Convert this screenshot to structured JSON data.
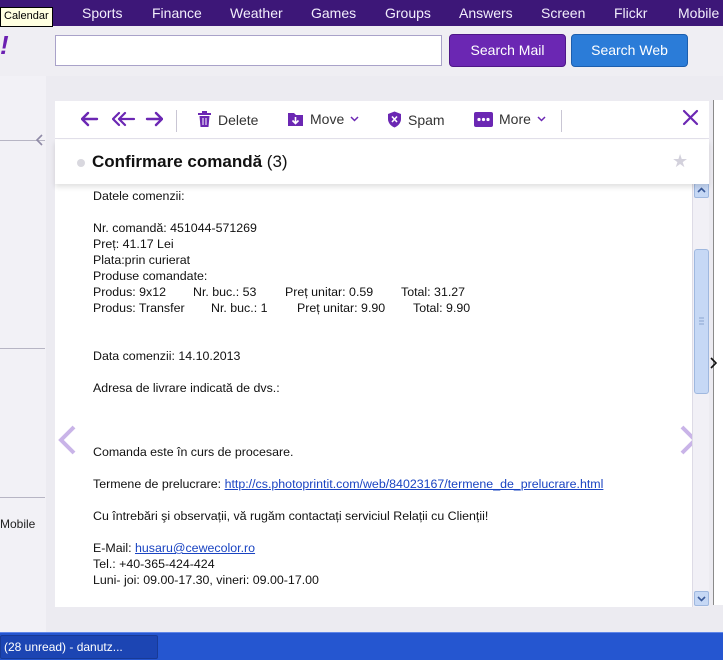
{
  "tooltip": "Calendar",
  "nav": {
    "items": [
      "Sports",
      "Finance",
      "Weather",
      "Games",
      "Groups",
      "Answers",
      "Screen",
      "Flickr",
      "Mobile"
    ]
  },
  "header": {
    "logo_fragment": "!",
    "search_value": "",
    "search_mail_label": "Search Mail",
    "search_web_label": "Search Web"
  },
  "sidebar": {
    "mobile_label": "Mobile"
  },
  "toolbar": {
    "reply_icon": "reply-icon",
    "reply_all_icon": "reply-all-icon",
    "forward_icon": "forward-icon",
    "delete_label": "Delete",
    "move_label": "Move",
    "spam_label": "Spam",
    "more_label": "More"
  },
  "message": {
    "subject": "Confirmare comandă",
    "count": "(3)",
    "intro": "Datele comenzii:",
    "order_number": "Nr. comandă: 451044-571269",
    "price": "Preț: 41.17 Lei",
    "payment": "Plata:prin curierat",
    "products_heading": "Produse comandate:",
    "products": [
      {
        "produs": "Produs: 9x12",
        "nr": "Nr. buc.: 53",
        "pret": "Preț unitar: 0.59",
        "total": "Total:  31.27"
      },
      {
        "produs": "Produs: Transfer",
        "nr": "Nr. buc.: 1",
        "pret": "Preț unitar: 9.90",
        "total": "Total:  9.90"
      }
    ],
    "order_date": "Data comenzii: 14.10.2013",
    "address_label": "Adresa de livrare indicată de dvs.:",
    "status": "Comanda este în curs de procesare.",
    "terms_label": "Termene de prelucrare:",
    "terms_link": "http://cs.photoprintit.com/web/84023167/termene_de_prelucrare.html",
    "contact_text": "Cu întrebări şi observații, vă rugăm contactați serviciul Relații cu Clienții!",
    "email_label": "E-Mail:",
    "email_link": "husaru@cewecolor.ro",
    "phone": "Tel.: +40-365-424-424",
    "hours": "Luni- joi: 09.00-17.30, vineri: 09.00-17.00"
  },
  "taskbar": {
    "item": "(28 unread) - danutz..."
  }
}
